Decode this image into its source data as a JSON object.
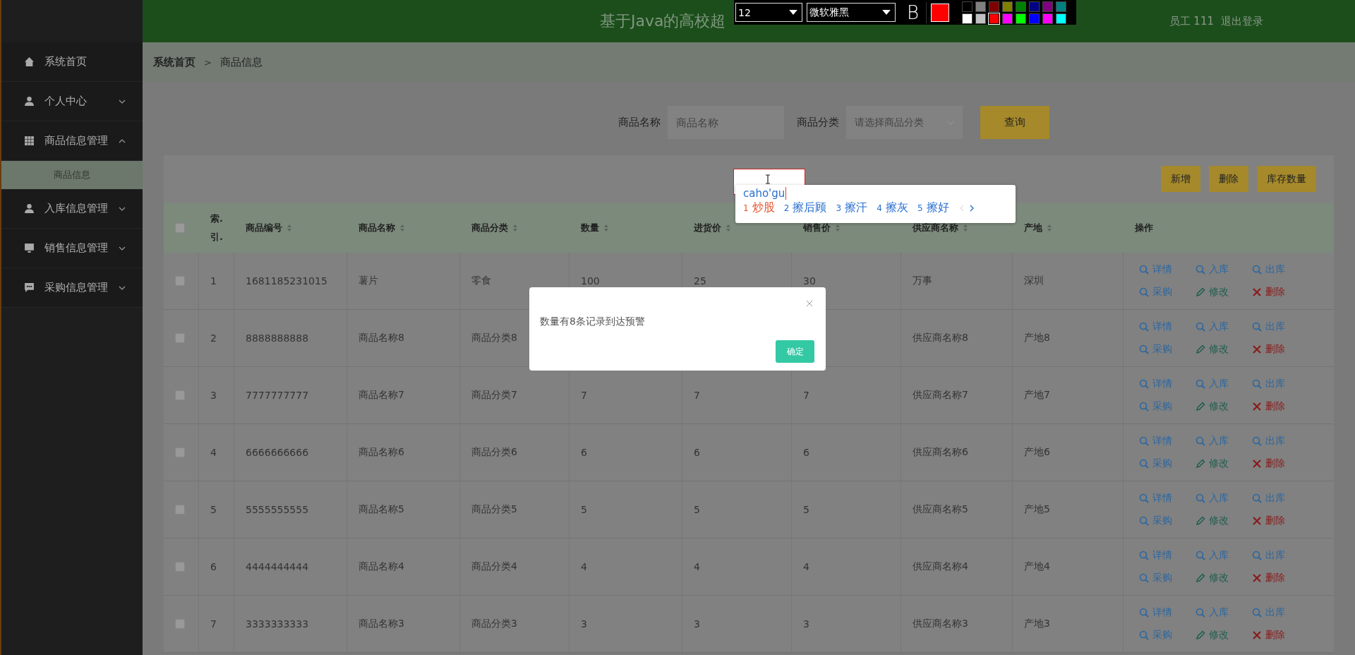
{
  "header": {
    "title": "基于Java的高校超",
    "user": "员工 111",
    "logout": "退出登录"
  },
  "drawing_toolbar": {
    "font_size": "12",
    "font": "微软雅黑",
    "bold_label": "B",
    "palette": [
      {
        "color": "#000000",
        "selected": false
      },
      {
        "color": "#808080",
        "selected": false
      },
      {
        "color": "#800000",
        "selected": false
      },
      {
        "color": "#808000",
        "selected": false
      },
      {
        "color": "#008000",
        "selected": false
      },
      {
        "color": "#000080",
        "selected": false
      },
      {
        "color": "#800080",
        "selected": false
      },
      {
        "color": "#008080",
        "selected": false
      },
      {
        "color": "#ffffff",
        "selected": false
      },
      {
        "color": "#c0c0c0",
        "selected": false
      },
      {
        "color": "#ff0000",
        "selected": true
      },
      {
        "color": "#ff00ff",
        "selected": false
      },
      {
        "color": "#00ff00",
        "selected": false
      },
      {
        "color": "#0000ff",
        "selected": false
      },
      {
        "color": "#ff00ff",
        "selected": false
      },
      {
        "color": "#00ffff",
        "selected": false
      }
    ]
  },
  "sidebar": {
    "items": [
      {
        "label": "系统首页",
        "kind": "home"
      },
      {
        "label": "个人中心",
        "kind": "user",
        "expanded": false
      },
      {
        "label": "商品信息管理",
        "kind": "grid",
        "expanded": true,
        "children": [
          {
            "label": "商品信息",
            "selected": true
          }
        ]
      },
      {
        "label": "入库信息管理",
        "kind": "user",
        "expanded": false
      },
      {
        "label": "销售信息管理",
        "kind": "monitor",
        "expanded": false
      },
      {
        "label": "采购信息管理",
        "kind": "chat",
        "expanded": false
      }
    ]
  },
  "breadcrumb": {
    "items": [
      "系统首页",
      "商品信息"
    ],
    "separator": ">"
  },
  "search": {
    "fields": [
      {
        "label": "商品名称",
        "kind": "input",
        "placeholder": "商品名称"
      },
      {
        "label": "商品分类",
        "kind": "select",
        "placeholder": "请选择商品分类"
      }
    ],
    "button": "查询"
  },
  "toolbar_buttons": [
    "新增",
    "删除",
    "库存数量"
  ],
  "table": {
    "header_checked": false,
    "columns": [
      {
        "label": "索. 引.",
        "sortable": false
      },
      {
        "label": "商品编号",
        "sortable": true
      },
      {
        "label": "商品名称",
        "sortable": true
      },
      {
        "label": "商品分类",
        "sortable": true
      },
      {
        "label": "数量",
        "sortable": true
      },
      {
        "label": "进货价",
        "sortable": true
      },
      {
        "label": "销售价",
        "sortable": true
      },
      {
        "label": "供应商名称",
        "sortable": true
      },
      {
        "label": "产地",
        "sortable": true
      },
      {
        "label": "操作",
        "sortable": false
      }
    ],
    "rows": [
      {
        "checked": false,
        "cells": [
          "1",
          "1681185231015",
          "薯片",
          "零食",
          "100",
          "25",
          "30",
          "万事",
          "深圳"
        ],
        "actions": [
          {
            "kind": "view",
            "label": "详情"
          },
          {
            "kind": "view",
            "label": "入库"
          },
          {
            "kind": "view",
            "label": "出库"
          },
          {
            "kind": "view",
            "label": "采购"
          },
          {
            "kind": "edit",
            "label": "修改"
          },
          {
            "kind": "delete",
            "label": "删除"
          }
        ]
      },
      {
        "checked": false,
        "cells": [
          "2",
          "8888888888",
          "商品名称8",
          "商品分类8",
          null,
          null,
          null,
          "供应商名称8",
          "产地8"
        ],
        "actions": [
          {
            "kind": "view",
            "label": "详情"
          },
          {
            "kind": "view",
            "label": "入库"
          },
          {
            "kind": "view",
            "label": "出库"
          },
          {
            "kind": "view",
            "label": "采购"
          },
          {
            "kind": "edit",
            "label": "修改"
          },
          {
            "kind": "delete",
            "label": "删除"
          }
        ]
      },
      {
        "checked": false,
        "cells": [
          "3",
          "7777777777",
          "商品名称7",
          "商品分类7",
          "7",
          "7",
          "7",
          "供应商名称7",
          "产地7"
        ],
        "actions": [
          {
            "kind": "view",
            "label": "详情"
          },
          {
            "kind": "view",
            "label": "入库"
          },
          {
            "kind": "view",
            "label": "出库"
          },
          {
            "kind": "view",
            "label": "采购"
          },
          {
            "kind": "edit",
            "label": "修改"
          },
          {
            "kind": "delete",
            "label": "删除"
          }
        ]
      },
      {
        "checked": false,
        "cells": [
          "4",
          "6666666666",
          "商品名称6",
          "商品分类6",
          "6",
          "6",
          "6",
          "供应商名称6",
          "产地6"
        ],
        "actions": [
          {
            "kind": "view",
            "label": "详情"
          },
          {
            "kind": "view",
            "label": "入库"
          },
          {
            "kind": "view",
            "label": "出库"
          },
          {
            "kind": "view",
            "label": "采购"
          },
          {
            "kind": "edit",
            "label": "修改"
          },
          {
            "kind": "delete",
            "label": "删除"
          }
        ]
      },
      {
        "checked": false,
        "cells": [
          "5",
          "5555555555",
          "商品名称5",
          "商品分类5",
          "5",
          "5",
          "5",
          "供应商名称5",
          "产地5"
        ],
        "actions": [
          {
            "kind": "view",
            "label": "详情"
          },
          {
            "kind": "view",
            "label": "入库"
          },
          {
            "kind": "view",
            "label": "出库"
          },
          {
            "kind": "view",
            "label": "采购"
          },
          {
            "kind": "edit",
            "label": "修改"
          },
          {
            "kind": "delete",
            "label": "删除"
          }
        ]
      },
      {
        "checked": false,
        "cells": [
          "6",
          "4444444444",
          "商品名称4",
          "商品分类4",
          "4",
          "4",
          "4",
          "供应商名称4",
          "产地4"
        ],
        "actions": [
          {
            "kind": "view",
            "label": "详情"
          },
          {
            "kind": "view",
            "label": "入库"
          },
          {
            "kind": "view",
            "label": "出库"
          },
          {
            "kind": "view",
            "label": "采购"
          },
          {
            "kind": "edit",
            "label": "修改"
          },
          {
            "kind": "delete",
            "label": "删除"
          }
        ]
      },
      {
        "checked": false,
        "cells": [
          "7",
          "3333333333",
          "商品名称3",
          "商品分类3",
          "3",
          "3",
          "3",
          "供应商名称3",
          "产地3"
        ],
        "actions": [
          {
            "kind": "view",
            "label": "详情"
          },
          {
            "kind": "view",
            "label": "入库"
          },
          {
            "kind": "view",
            "label": "出库"
          },
          {
            "kind": "view",
            "label": "采购"
          },
          {
            "kind": "edit",
            "label": "修改"
          },
          {
            "kind": "delete",
            "label": "删除"
          }
        ]
      }
    ]
  },
  "ime": {
    "composition": "caho'gu",
    "candidates": [
      {
        "index": "1",
        "text": "炒股",
        "selected": true
      },
      {
        "index": "2",
        "text": "擦后顾",
        "selected": false
      },
      {
        "index": "3",
        "text": "擦汗",
        "selected": false
      },
      {
        "index": "4",
        "text": "擦灰",
        "selected": false
      },
      {
        "index": "5",
        "text": "擦好",
        "selected": false
      }
    ]
  },
  "dialog": {
    "message": "数量有8条记录到达预警",
    "button": "确定"
  }
}
